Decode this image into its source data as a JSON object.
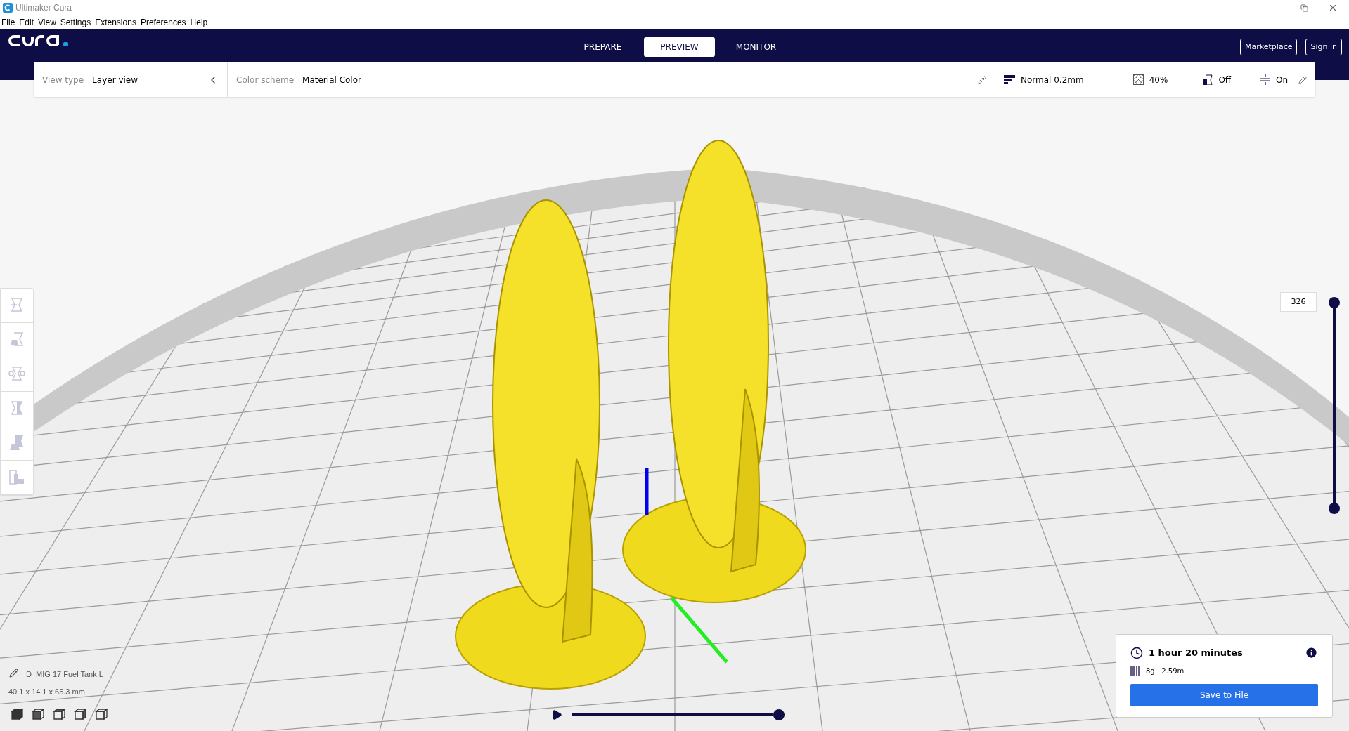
{
  "window": {
    "title": "Ultimaker Cura"
  },
  "menu": [
    "File",
    "Edit",
    "View",
    "Settings",
    "Extensions",
    "Preferences",
    "Help"
  ],
  "stages": [
    {
      "label": "PREPARE",
      "selected": false
    },
    {
      "label": "PREVIEW",
      "selected": true
    },
    {
      "label": "MONITOR",
      "selected": false
    }
  ],
  "account_buttons": [
    "Marketplace",
    "Sign in"
  ],
  "view_type": {
    "label": "View type",
    "value": "Layer view"
  },
  "color_scheme": {
    "label": "Color scheme",
    "value": "Material Color"
  },
  "print_setup": {
    "profile": "Normal 0.2mm",
    "infill": "40%",
    "support": "Off",
    "adhesion": "On"
  },
  "layer_slider": {
    "value": "326"
  },
  "simulation": {
    "level": 1
  },
  "object": {
    "name": "D_MIG 17 Fuel Tank L",
    "dimensions": "40.1 x 14.1 x 65.3 mm"
  },
  "print_info": {
    "time": "1 hour 20 minutes",
    "material": "8g · 2.59m",
    "action": "Save to File"
  }
}
